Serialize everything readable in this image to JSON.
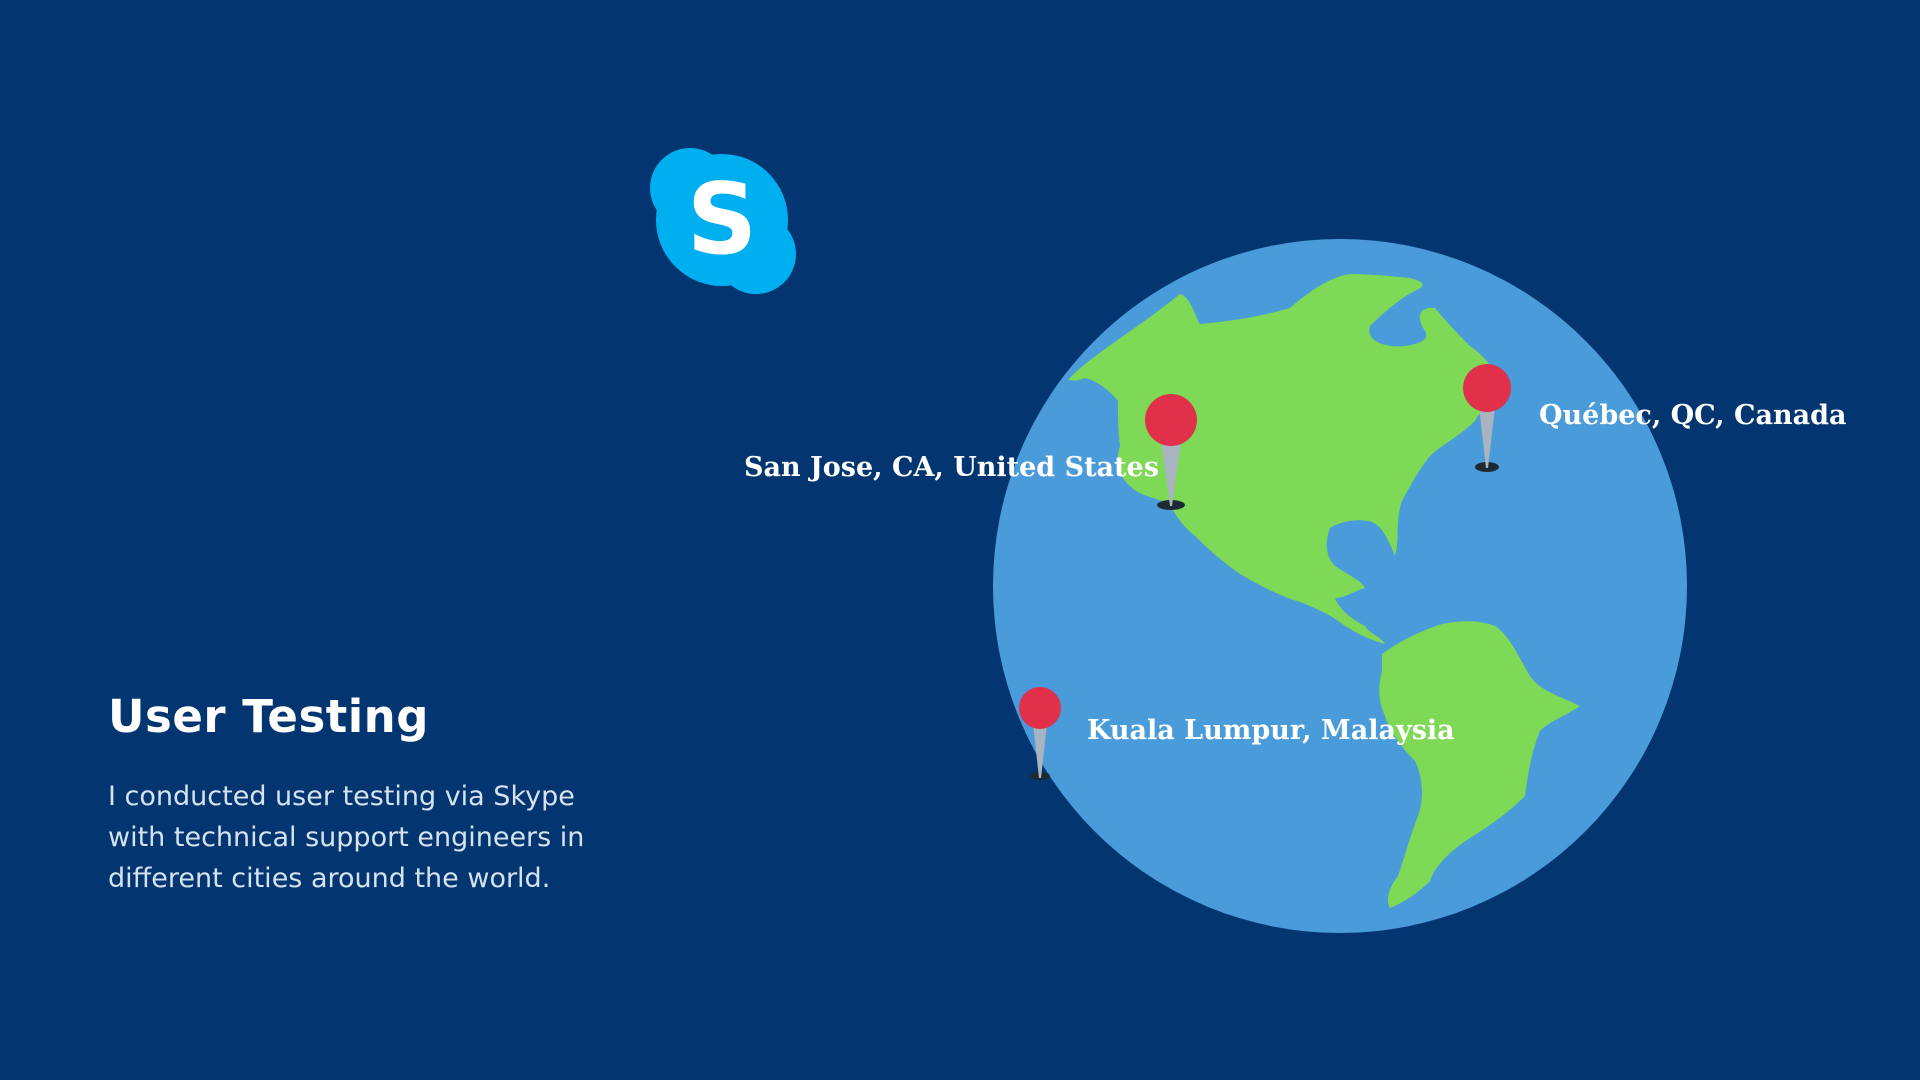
{
  "theme": {
    "background": "#033670",
    "body_text_color": "#D6E2F0",
    "logo_color": "#00AFF0",
    "ocean_color": "#4A9BDA",
    "land_color": "#7ED957",
    "pin_head_color": "#E0304A",
    "pin_needle_color": "#A8B4C0",
    "pin_shadow_color": "#1E2A33"
  },
  "logo": {
    "icon": "skype-icon",
    "letter": "S"
  },
  "section": {
    "title": "User Testing",
    "description_lines": [
      "I conducted user testing via Skype",
      "with technical support engineers in",
      "different cities around the world."
    ]
  },
  "globe": {
    "icon": "globe-icon"
  },
  "locations": [
    {
      "name": "San Jose, CA, United States",
      "icon": "map-pin-icon"
    },
    {
      "name": "Québec, QC, Canada",
      "icon": "map-pin-icon"
    },
    {
      "name": "Kuala Lumpur, Malaysia",
      "icon": "map-pin-icon"
    }
  ]
}
